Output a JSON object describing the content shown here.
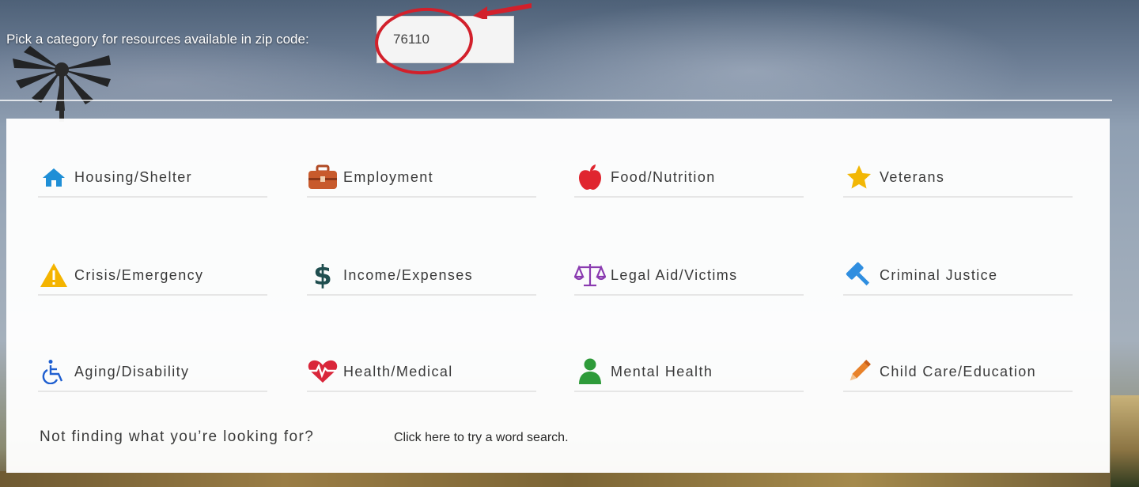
{
  "zip": {
    "label": "Pick a category for resources available in zip code:",
    "value": "76110"
  },
  "categories": [
    {
      "label": "Housing/Shelter",
      "icon": "house-icon",
      "color": "#1f8fd6"
    },
    {
      "label": "Employment",
      "icon": "briefcase-icon",
      "color": "#c0522a"
    },
    {
      "label": "Food/Nutrition",
      "icon": "apple-icon",
      "color": "#e0262f"
    },
    {
      "label": "Veterans",
      "icon": "star-icon",
      "color": "#f2b705"
    },
    {
      "label": "Crisis/Emergency",
      "icon": "warning-icon",
      "color": "#f4b400"
    },
    {
      "label": "Income/Expenses",
      "icon": "dollar-icon",
      "color": "#1f4e4f"
    },
    {
      "label": "Legal Aid/Victims",
      "icon": "scales-icon",
      "color": "#8a3bb0"
    },
    {
      "label": "Criminal Justice",
      "icon": "gavel-icon",
      "color": "#2f8ee0"
    },
    {
      "label": "Aging/Disability",
      "icon": "wheelchair-icon",
      "color": "#1f5fd0"
    },
    {
      "label": "Health/Medical",
      "icon": "heartbeat-icon",
      "color": "#d9263a"
    },
    {
      "label": "Mental Health",
      "icon": "person-icon",
      "color": "#2e9b3a"
    },
    {
      "label": "Child Care/Education",
      "icon": "pencil-icon",
      "color": "#e8822a"
    }
  ],
  "footer": {
    "prompt": "Not finding what you’re looking for?",
    "link": "Click here to try a word search."
  }
}
